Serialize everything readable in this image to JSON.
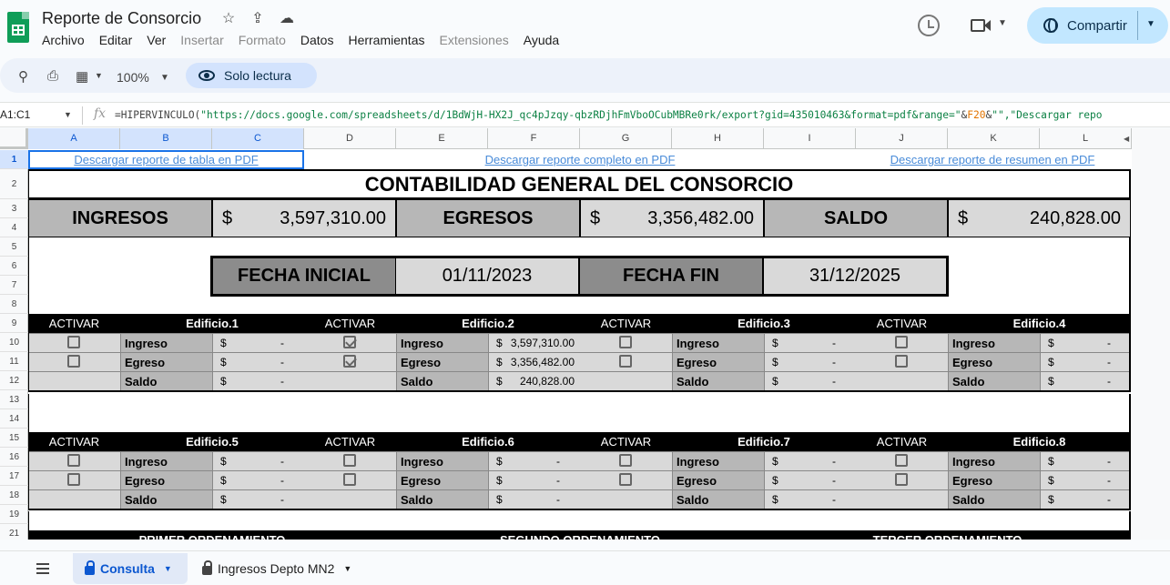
{
  "app": {
    "title": "Reporte de Consorcio",
    "icons": [
      "star-icon",
      "move-to-drive-icon",
      "cloud-saved-icon"
    ],
    "menu": [
      {
        "label": "Archivo",
        "enabled": true
      },
      {
        "label": "Editar",
        "enabled": true
      },
      {
        "label": "Ver",
        "enabled": true
      },
      {
        "label": "Insertar",
        "enabled": false
      },
      {
        "label": "Formato",
        "enabled": false
      },
      {
        "label": "Datos",
        "enabled": true
      },
      {
        "label": "Herramientas",
        "enabled": true
      },
      {
        "label": "Extensiones",
        "enabled": false
      },
      {
        "label": "Ayuda",
        "enabled": true
      }
    ],
    "share_label": "Compartir"
  },
  "toolbar": {
    "zoom": "100%",
    "readonly_label": "Solo lectura"
  },
  "formula_bar": {
    "name_box": "A1:C1",
    "fx": "fx",
    "formula_start": "=HIPERVINCULO(",
    "formula_url": "\"https://docs.google.com/spreadsheets/d/1BdWjH-HX2J_qc4pJzqy-qbzRDjhFmVboOCubMBRe0rk/export?gid=435010463&format=pdf&range=\"",
    "formula_amp1": "&",
    "formula_ref": "F20",
    "formula_amp2": "&",
    "formula_end": "\"\",\"Descargar repo"
  },
  "columns": [
    "A",
    "B",
    "C",
    "D",
    "E",
    "F",
    "G",
    "H",
    "I",
    "J",
    "K",
    "L"
  ],
  "rows": [
    "1",
    "2",
    "3",
    "4",
    "5",
    "6",
    "7",
    "8",
    "9",
    "10",
    "11",
    "12",
    "13",
    "14",
    "15",
    "16",
    "17",
    "18",
    "19",
    "21"
  ],
  "sheet": {
    "links": {
      "table_pdf": "Descargar reporte de tabla en PDF",
      "full_pdf": "Descargar reporte completo en PDF",
      "summary_pdf": "Descargar reporte de resumen en PDF"
    },
    "title": "CONTABILIDAD GENERAL DEL CONSORCIO",
    "totals": {
      "ingresos_label": "INGRESOS",
      "ingresos_cur": "$",
      "ingresos_value": "3,597,310.00",
      "egresos_label": "EGRESOS",
      "egresos_cur": "$",
      "egresos_value": "3,356,482.00",
      "saldo_label": "SALDO",
      "saldo_cur": "$",
      "saldo_value": "240,828.00"
    },
    "dates": {
      "start_label": "FECHA INICIAL",
      "start_value": "01/11/2023",
      "end_label": "FECHA FIN",
      "end_value": "31/12/2025"
    },
    "activar_label": "ACTIVAR",
    "row_labels": {
      "ingreso": "Ingreso",
      "egreso": "Egreso",
      "saldo": "Saldo"
    },
    "buildings": [
      {
        "name": "Edificio.1",
        "ingreso_cur": "$",
        "ingreso_val": "-",
        "egreso_cur": "$",
        "egreso_val": "-",
        "saldo_cur": "$",
        "saldo_val": "-",
        "ingreso_checked": false,
        "egreso_checked": false
      },
      {
        "name": "Edificio.2",
        "ingreso_cur": "$",
        "ingreso_val": "3,597,310.00",
        "egreso_cur": "$",
        "egreso_val": "3,356,482.00",
        "saldo_cur": "$",
        "saldo_val": "240,828.00",
        "ingreso_checked": true,
        "egreso_checked": true
      },
      {
        "name": "Edificio.3",
        "ingreso_cur": "$",
        "ingreso_val": "-",
        "egreso_cur": "$",
        "egreso_val": "-",
        "saldo_cur": "$",
        "saldo_val": "-",
        "ingreso_checked": false,
        "egreso_checked": false
      },
      {
        "name": "Edificio.4",
        "ingreso_cur": "$",
        "ingreso_val": "-",
        "egreso_cur": "$",
        "egreso_val": "-",
        "saldo_cur": "$",
        "saldo_val": "-",
        "ingreso_checked": false,
        "egreso_checked": false
      },
      {
        "name": "Edificio.5",
        "ingreso_cur": "$",
        "ingreso_val": "-",
        "egreso_cur": "$",
        "egreso_val": "-",
        "saldo_cur": "$",
        "saldo_val": "-",
        "ingreso_checked": false,
        "egreso_checked": false
      },
      {
        "name": "Edificio.6",
        "ingreso_cur": "$",
        "ingreso_val": "-",
        "egreso_cur": "$",
        "egreso_val": "-",
        "saldo_cur": "$",
        "saldo_val": "-",
        "ingreso_checked": false,
        "egreso_checked": false
      },
      {
        "name": "Edificio.7",
        "ingreso_cur": "$",
        "ingreso_val": "-",
        "egreso_cur": "$",
        "egreso_val": "-",
        "saldo_cur": "$",
        "saldo_val": "-",
        "ingreso_checked": false,
        "egreso_checked": false
      },
      {
        "name": "Edificio.8",
        "ingreso_cur": "$",
        "ingreso_val": "-",
        "egreso_cur": "$",
        "egreso_val": "-",
        "saldo_cur": "$",
        "saldo_val": "-",
        "ingreso_checked": false,
        "egreso_checked": false
      }
    ],
    "ordering": [
      "PRIMER ORDENAMIENTO",
      "SEGUNDO ORDENAMIENTO",
      "TERCER ORDENAMIENTO"
    ]
  },
  "tabs": [
    {
      "label": "Consulta",
      "active": true
    },
    {
      "label": "Ingresos Depto MN2",
      "active": false
    }
  ]
}
